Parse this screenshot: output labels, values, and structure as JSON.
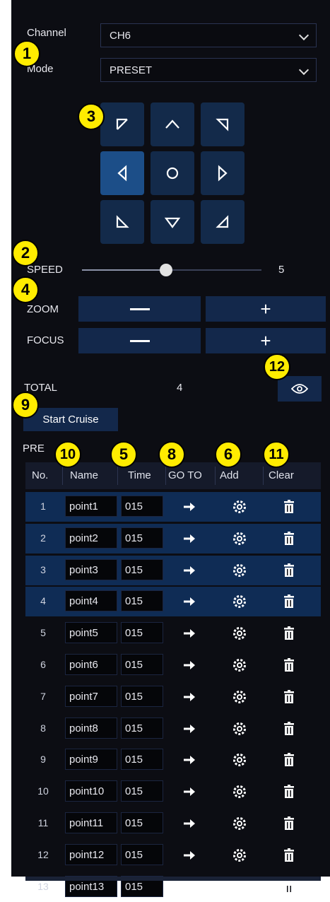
{
  "channel": {
    "label": "Channel",
    "value": "CH6"
  },
  "mode": {
    "label": "Mode",
    "value": "PRESET"
  },
  "speed": {
    "label": "SPEED",
    "value": "5",
    "level": 0.5
  },
  "zoom": {
    "label": "ZOOM",
    "minus": "—",
    "plus": "+"
  },
  "focus": {
    "label": "FOCUS",
    "minus": "—",
    "plus": "+"
  },
  "total": {
    "label": "TOTAL",
    "value": "4"
  },
  "start_cruise": "Start Cruise",
  "preset_label": "PRE",
  "columns": {
    "no": "No.",
    "name": "Name",
    "time": "Time",
    "goto": "GO TO",
    "add": "Add",
    "clear": "Clear"
  },
  "rows": [
    {
      "no": "1",
      "name": "point1",
      "time": "015"
    },
    {
      "no": "2",
      "name": "point2",
      "time": "015"
    },
    {
      "no": "3",
      "name": "point3",
      "time": "015"
    },
    {
      "no": "4",
      "name": "point4",
      "time": "015"
    },
    {
      "no": "5",
      "name": "point5",
      "time": "015"
    },
    {
      "no": "6",
      "name": "point6",
      "time": "015"
    },
    {
      "no": "7",
      "name": "point7",
      "time": "015"
    },
    {
      "no": "8",
      "name": "point8",
      "time": "015"
    },
    {
      "no": "9",
      "name": "point9",
      "time": "015"
    },
    {
      "no": "10",
      "name": "point10",
      "time": "015"
    },
    {
      "no": "11",
      "name": "point11",
      "time": "015"
    },
    {
      "no": "12",
      "name": "point12",
      "time": "015"
    },
    {
      "no": "13",
      "name": "point13",
      "time": "015"
    }
  ],
  "selected_rows": 4,
  "badges": {
    "b1": "1",
    "b2": "2",
    "b3": "3",
    "b4": "4",
    "b5": "5",
    "b6": "6",
    "b8": "8",
    "b9": "9",
    "b10": "10",
    "b11": "11",
    "b12": "12"
  },
  "icons": {
    "goto": "arrow-right-icon",
    "add": "gear-icon",
    "clear": "trash-icon",
    "preview": "eye-icon"
  },
  "colors": {
    "panel": "#0c0d13",
    "button": "#13284b",
    "selected_row": "#0f2c55",
    "badge": "#ffec00"
  }
}
